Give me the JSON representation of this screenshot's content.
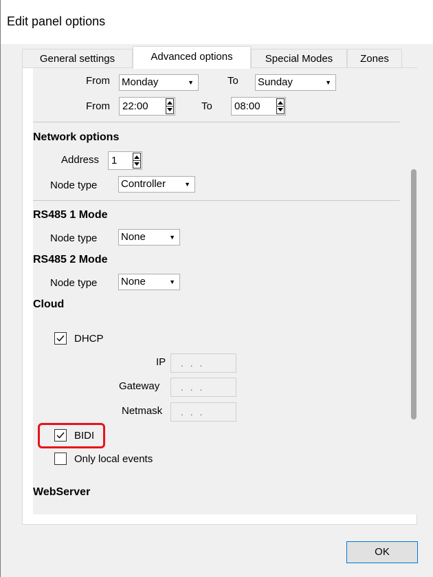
{
  "window": {
    "title": "Edit panel options"
  },
  "tabs": [
    {
      "label": "General settings"
    },
    {
      "label": "Advanced options"
    },
    {
      "label": "Special Modes"
    },
    {
      "label": "Zones"
    }
  ],
  "schedule": {
    "row1": {
      "from_label": "From",
      "from_value": "Monday",
      "to_label": "To",
      "to_value": "Sunday"
    },
    "row2": {
      "from_label": "From",
      "from_value": "22:00",
      "to_label": "To",
      "to_value": "08:00"
    }
  },
  "network": {
    "heading": "Network options",
    "address_label": "Address",
    "address_value": "1",
    "node_type_label": "Node type",
    "node_type_value": "Controller"
  },
  "rs485_1": {
    "heading": "RS485 1 Mode",
    "node_type_label": "Node type",
    "node_type_value": "None"
  },
  "rs485_2": {
    "heading": "RS485 2 Mode",
    "node_type_label": "Node type",
    "node_type_value": "None"
  },
  "cloud": {
    "heading": "Cloud",
    "dhcp_label": "DHCP",
    "dhcp_checked": true,
    "ip_label": "IP",
    "ip_value": ". . .",
    "gateway_label": "Gateway",
    "gateway_value": ". . .",
    "netmask_label": "Netmask",
    "netmask_value": ". . .",
    "bidi_label": "BIDI",
    "bidi_checked": true,
    "local_events_label": "Only local events",
    "local_events_checked": false
  },
  "webserver": {
    "heading": "WebServer"
  },
  "footer": {
    "ok_label": "OK"
  },
  "colors": {
    "highlight": "#e8131b",
    "accent": "#0078d7"
  }
}
